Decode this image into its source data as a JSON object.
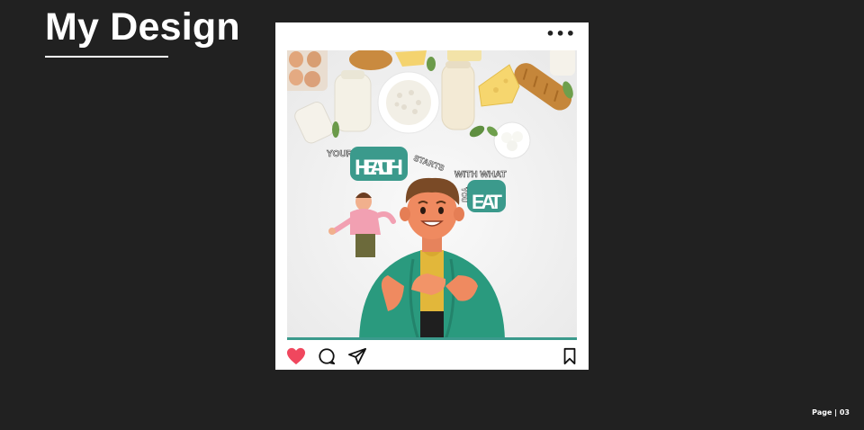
{
  "page": {
    "title": "My Design",
    "page_number": "Page | 03"
  },
  "post": {
    "menu_glyph": "•••",
    "headline": {
      "part1": "YOUR",
      "part2": "HEALTH",
      "part3": "STARTS",
      "part4": "WITH WHAT",
      "part5": "YOU",
      "part6": "EAT"
    },
    "actions": [
      "heart-icon",
      "comment-icon",
      "share-icon",
      "bookmark-icon"
    ]
  },
  "colors": {
    "background": "#212121",
    "accent": "#3b9a8c",
    "heart": "#f0475e"
  }
}
